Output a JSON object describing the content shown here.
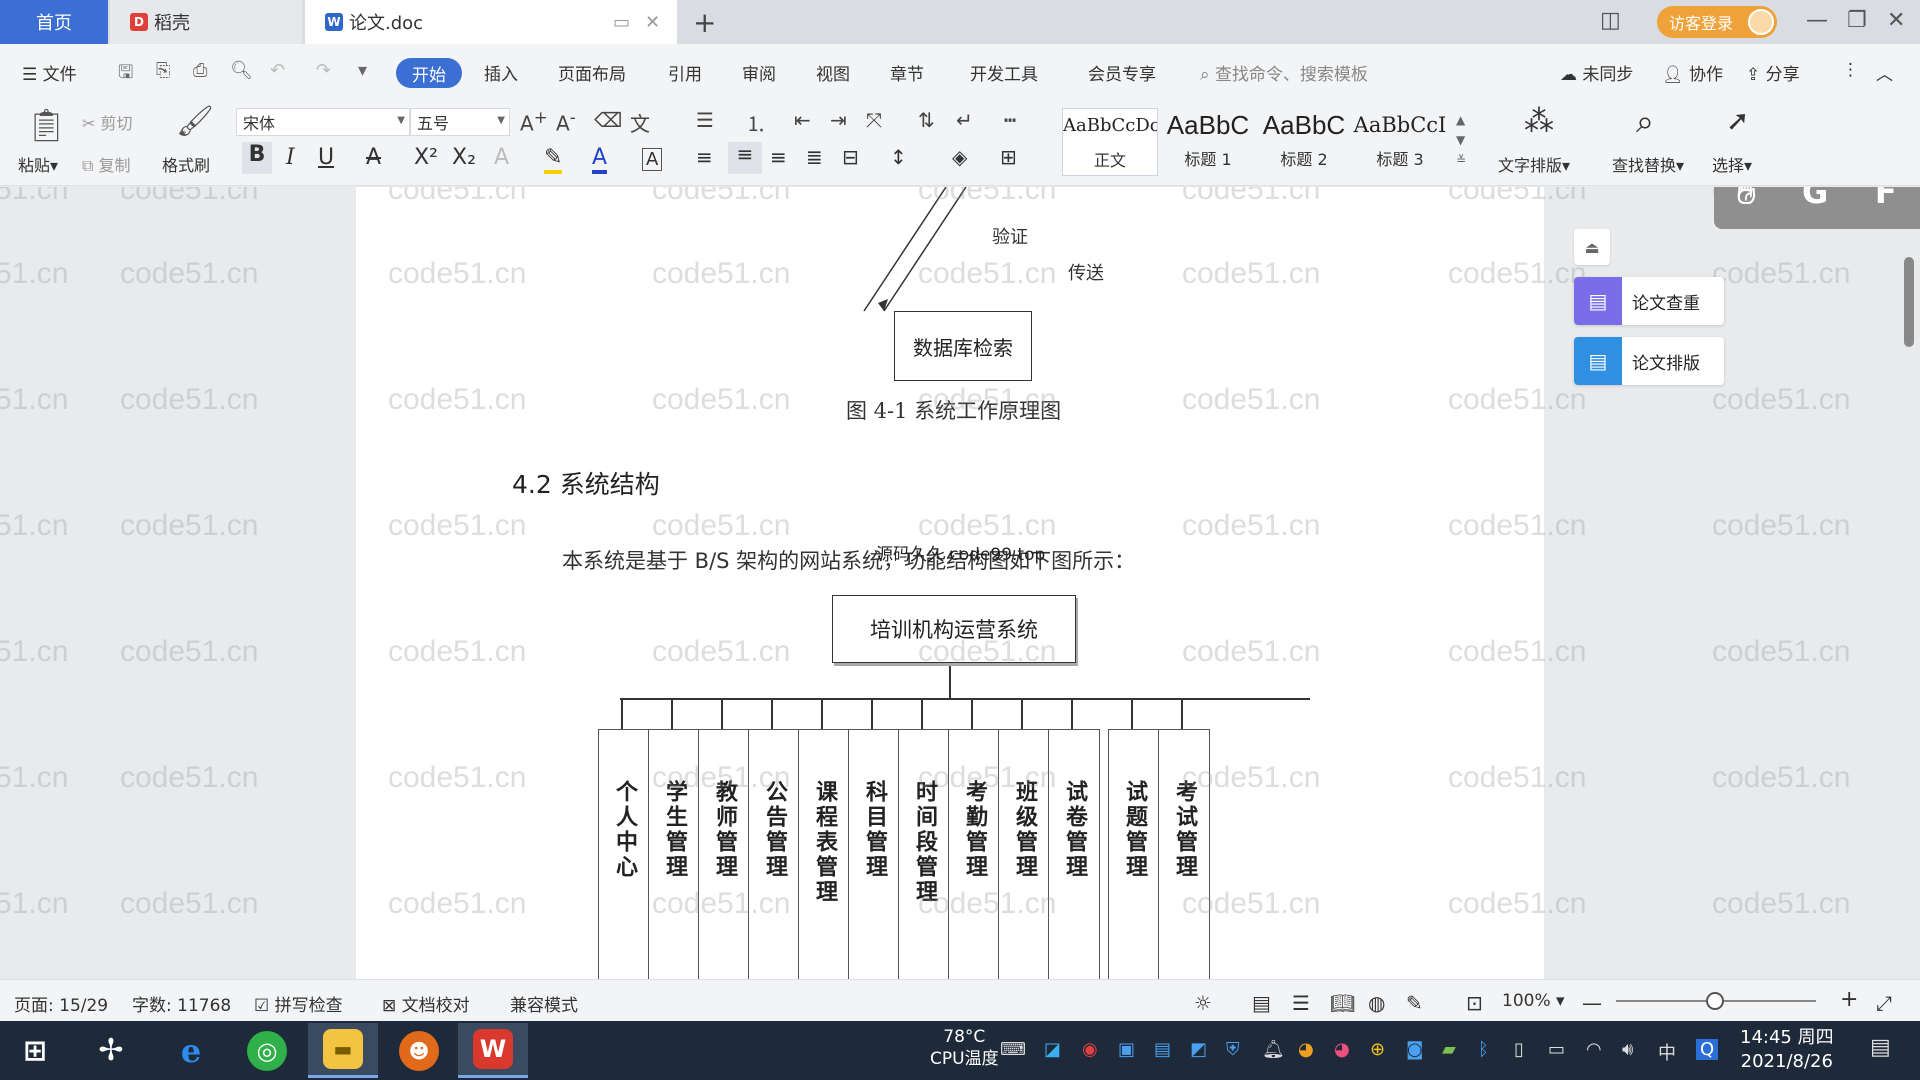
{
  "tabs": {
    "home": "首页",
    "daoke": "稻壳",
    "doc": "论文.doc",
    "login": "访客登录"
  },
  "menu": {
    "file": "文件",
    "items": [
      "开始",
      "插入",
      "页面布局",
      "引用",
      "审阅",
      "视图",
      "章节",
      "开发工具",
      "会员专享"
    ],
    "search_placeholder": "查找命令、搜索模板",
    "sync": "未同步",
    "collab": "协作",
    "share": "分享"
  },
  "ribbon": {
    "paste": "粘贴",
    "cut": "剪切",
    "copy": "复制",
    "format_painter": "格式刷",
    "font_name": "宋体",
    "font_size": "五号",
    "styles": [
      {
        "preview": "AaBbCcDc",
        "label": "正文"
      },
      {
        "preview": "AaBbC",
        "label": "标题 1"
      },
      {
        "preview": "AaBbC",
        "label": "标题 2"
      },
      {
        "preview": "AaBbCcI",
        "label": "标题 3"
      }
    ],
    "text_layout": "文字排版",
    "find_replace": "查找替换",
    "select": "选择"
  },
  "document": {
    "label_verify": "验证",
    "label_send": "传送",
    "db_box": "数据库检索",
    "figure_caption": "图 4-1 系统工作原理图",
    "section_heading": "4.2 系统结构",
    "paragraph": "本系统是基于 B/S 架构的网站系统，功能结构图如下图所示：",
    "inline_watermark": "源码久久 code99.top",
    "root_node": "培训机构运营系统",
    "modules": [
      "个人中心",
      "学生管理",
      "教师管理",
      "公告管理",
      "课程表管理",
      "科目管理",
      "时间段管理",
      "考勤管理",
      "班级管理",
      "试卷管理",
      "试题管理",
      "考试管理"
    ],
    "watermark": "code51.cn"
  },
  "side_panel": {
    "check": "论文查重",
    "layout": "论文排版",
    "float_letters": [
      "G",
      "F"
    ]
  },
  "status": {
    "page": "页面: 15/29",
    "words": "字数: 11768",
    "spell": "拼写检查",
    "proof": "文档校对",
    "compat": "兼容模式",
    "zoom": "100%"
  },
  "taskbar": {
    "temp": "78°C",
    "cpu": "CPU温度",
    "ime": "中",
    "time": "14:45 周四",
    "date": "2021/8/26"
  },
  "colors": {
    "accent": "#3b6fd4",
    "login": "#f0a23a",
    "taskbar": "#1e2a3a"
  }
}
